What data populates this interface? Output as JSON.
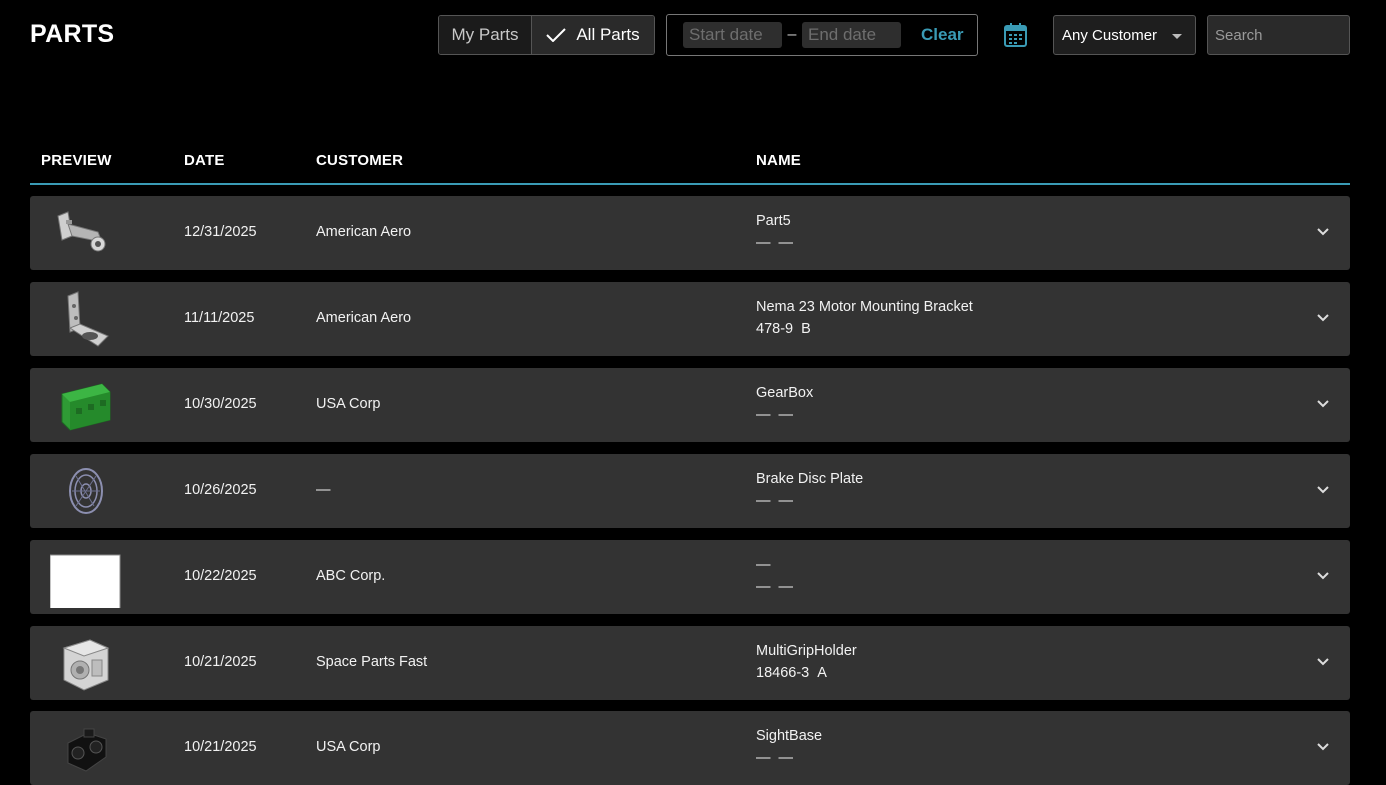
{
  "header": {
    "title": "PARTS",
    "toggle": {
      "my_parts": "My Parts",
      "all_parts": "All Parts"
    },
    "date_range": {
      "start_placeholder": "Start date",
      "separator": "–",
      "end_placeholder": "End date",
      "clear": "Clear"
    },
    "customer_select": "Any Customer",
    "search_placeholder": "Search"
  },
  "colors": {
    "accent": "#3a9bb5",
    "row_bg": "#333333"
  },
  "table": {
    "columns": [
      "PREVIEW",
      "DATE",
      "CUSTOMER",
      "NAME"
    ],
    "rows": [
      {
        "preview": "bracket-arm-part-icon",
        "date": "12/31/2025",
        "customer": "American Aero",
        "name": "Part5",
        "part_number": "—",
        "revision": "—"
      },
      {
        "preview": "motor-bracket-part-icon",
        "date": "11/11/2025",
        "customer": "American Aero",
        "name": "Nema 23 Motor Mounting Bracket",
        "part_number": "478-9",
        "revision": "B"
      },
      {
        "preview": "gearbox-part-icon",
        "date": "10/30/2025",
        "customer": "USA Corp",
        "name": "GearBox",
        "part_number": "—",
        "revision": "—"
      },
      {
        "preview": "brake-disc-part-icon",
        "date": "10/26/2025",
        "customer": "—",
        "name": "Brake Disc Plate",
        "part_number": "—",
        "revision": "—"
      },
      {
        "preview": "blank-preview-icon",
        "date": "10/22/2025",
        "customer": "ABC Corp.",
        "name": "—",
        "part_number": "—",
        "revision": "—"
      },
      {
        "preview": "grip-holder-part-icon",
        "date": "10/21/2025",
        "customer": "Space Parts Fast",
        "name": "MultiGripHolder",
        "part_number": "18466-3",
        "revision": "A"
      },
      {
        "preview": "sight-base-part-icon",
        "date": "10/21/2025",
        "customer": "USA Corp",
        "name": "SightBase",
        "part_number": "—",
        "revision": "—"
      }
    ]
  }
}
